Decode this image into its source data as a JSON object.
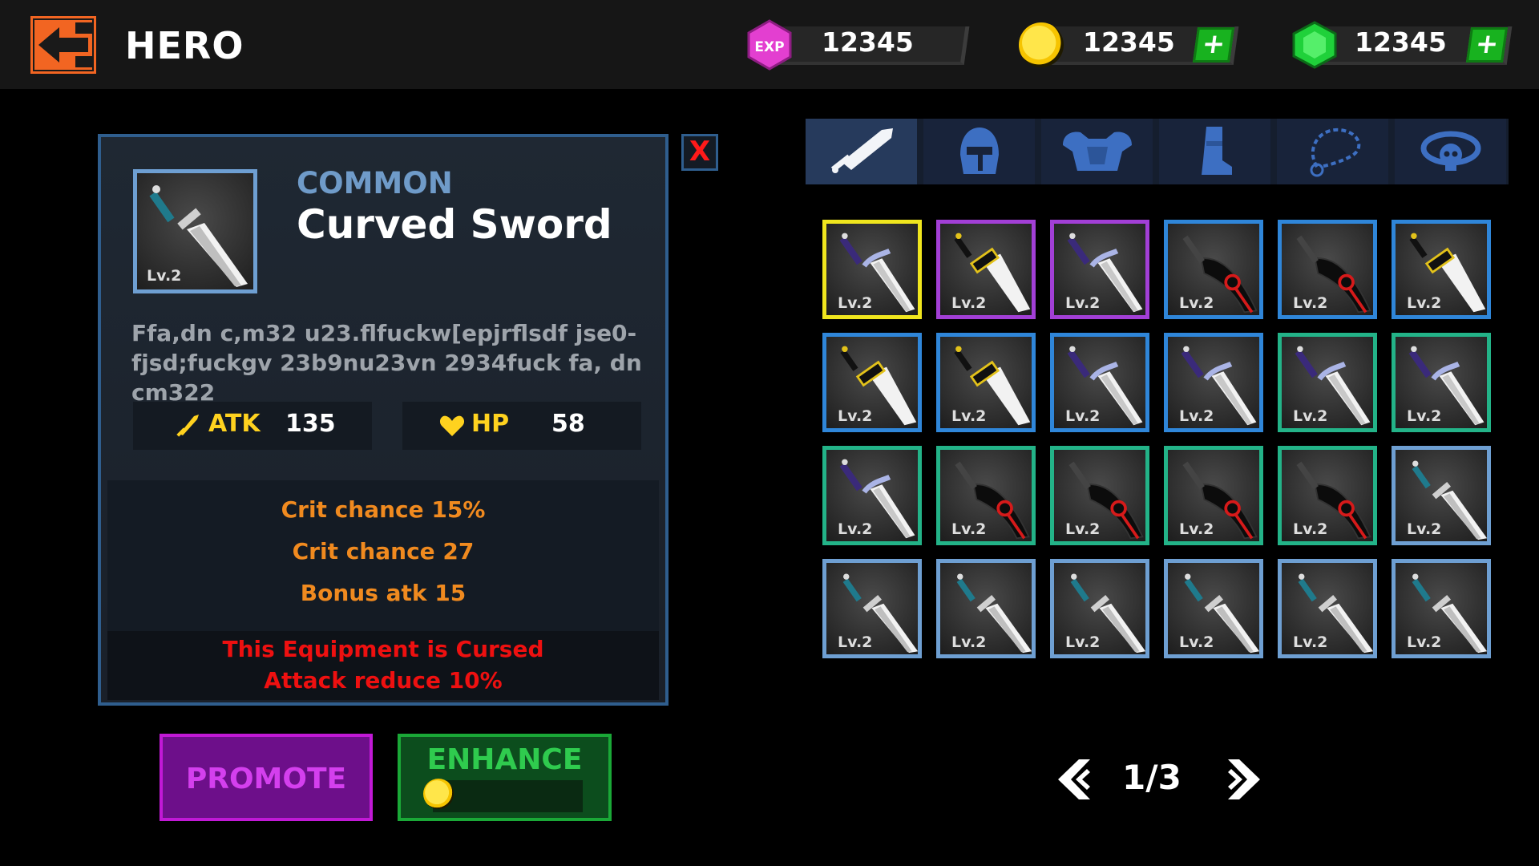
{
  "header": {
    "title": "HERO",
    "exp": {
      "badge": "EXP",
      "value": "12345"
    },
    "gold": {
      "value": "12345",
      "plus": "+"
    },
    "gems": {
      "value": "12345",
      "plus": "+"
    }
  },
  "detail": {
    "close": "X",
    "rarity": "COMMON",
    "name": "Curved Sword",
    "level": "Lv.2",
    "description": "Ffa,dn c,m32 u23.flfuckw[epjrflsdf jse0-fjsd;fuckgv 23b9nu23vn 2934fuck fa, dn cm322",
    "stats": [
      {
        "label": "ATK",
        "value": "135"
      },
      {
        "label": "HP",
        "value": "58"
      }
    ],
    "bonuses": [
      "Crit chance 15%",
      "Crit chance  27",
      "Bonus atk 15"
    ],
    "curse": [
      "This Equipment is Cursed",
      "Attack reduce 10%"
    ]
  },
  "actions": {
    "promote": "PROMOTE",
    "enhance": "ENHANCE",
    "enhance_progress": 0.0
  },
  "tabs": [
    {
      "name": "sword",
      "icon": "sword-icon",
      "active": true
    },
    {
      "name": "helmet",
      "icon": "helmet-icon"
    },
    {
      "name": "armor",
      "icon": "armor-icon"
    },
    {
      "name": "boots",
      "icon": "boot-icon"
    },
    {
      "name": "necklace",
      "icon": "necklace-icon"
    },
    {
      "name": "ring",
      "icon": "skull-ring-icon"
    }
  ],
  "inventory": {
    "rows": [
      [
        {
          "level": "Lv.2",
          "rarity": "#f0e61e",
          "weapon": "broadsword"
        },
        {
          "level": "Lv.2",
          "rarity": "#a23fd6",
          "weapon": "cleaver"
        },
        {
          "level": "Lv.2",
          "rarity": "#a23fd6",
          "weapon": "broadsword"
        },
        {
          "level": "Lv.2",
          "rarity": "#2f86d9",
          "weapon": "scythe"
        },
        {
          "level": "Lv.2",
          "rarity": "#2f86d9",
          "weapon": "scythe"
        },
        {
          "level": "Lv.2",
          "rarity": "#2f86d9",
          "weapon": "cleaver"
        }
      ],
      [
        {
          "level": "Lv.2",
          "rarity": "#2f86d9",
          "weapon": "cleaver"
        },
        {
          "level": "Lv.2",
          "rarity": "#2f86d9",
          "weapon": "cleaver"
        },
        {
          "level": "Lv.2",
          "rarity": "#2f86d9",
          "weapon": "broadsword"
        },
        {
          "level": "Lv.2",
          "rarity": "#2f86d9",
          "weapon": "broadsword"
        },
        {
          "level": "Lv.2",
          "rarity": "#23b388",
          "weapon": "broadsword"
        },
        {
          "level": "Lv.2",
          "rarity": "#23b388",
          "weapon": "broadsword"
        }
      ],
      [
        {
          "level": "Lv.2",
          "rarity": "#23b388",
          "weapon": "broadsword"
        },
        {
          "level": "Lv.2",
          "rarity": "#23b388",
          "weapon": "scythe"
        },
        {
          "level": "Lv.2",
          "rarity": "#23b388",
          "weapon": "scythe"
        },
        {
          "level": "Lv.2",
          "rarity": "#23b388",
          "weapon": "scythe"
        },
        {
          "level": "Lv.2",
          "rarity": "#23b388",
          "weapon": "scythe"
        },
        {
          "level": "Lv.2",
          "rarity": "#6e9fd2",
          "weapon": "curved"
        }
      ],
      [
        {
          "level": "Lv.2",
          "rarity": "#6e9fd2",
          "weapon": "curved"
        },
        {
          "level": "Lv.2",
          "rarity": "#6e9fd2",
          "weapon": "curved"
        },
        {
          "level": "Lv.2",
          "rarity": "#6e9fd2",
          "weapon": "curved"
        },
        {
          "level": "Lv.2",
          "rarity": "#6e9fd2",
          "weapon": "curved"
        },
        {
          "level": "Lv.2",
          "rarity": "#6e9fd2",
          "weapon": "curved"
        },
        {
          "level": "Lv.2",
          "rarity": "#6e9fd2",
          "weapon": "curved"
        }
      ]
    ]
  },
  "pagination": {
    "text": "1/3"
  },
  "colors": {
    "accent": "#f26522",
    "rarity_common": "#6e9fd2",
    "stat_label": "#ffd21f",
    "bonus": "#f08a1f",
    "curse": "#ee1010",
    "promote": "#c119d6",
    "enhance": "#1aa837"
  }
}
